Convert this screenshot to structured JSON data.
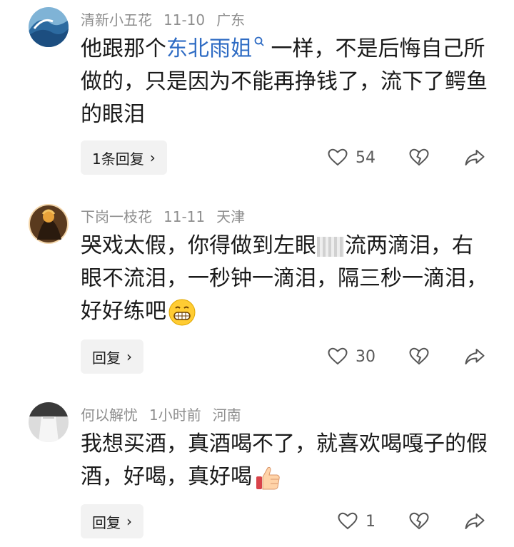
{
  "comments": [
    {
      "username": "清新小五花",
      "date": "11-10",
      "location": "广东",
      "text_before": "他跟那个",
      "link_text": "东北雨姐",
      "text_after": "一样，不是后悔自己所做的，只是因为不能再挣钱了，流下了鳄鱼的眼泪",
      "reply_label": "1条回复",
      "likes": "54"
    },
    {
      "username": "下岗一枝花",
      "date": "11-11",
      "location": "天津",
      "text_before": "哭戏太假，你得做到左眼",
      "text_middle": "流两滴泪，右眼不流泪，一秒钟一滴泪，隔三秒一滴泪，好好练吧",
      "reply_label": "回复",
      "likes": "30"
    },
    {
      "username": "何以解忧",
      "date": "1小时前",
      "location": "河南",
      "text": "我想买酒，真酒喝不了，就喜欢喝嘎子的假酒，好喝，真好喝",
      "reply_label": "回复",
      "likes": "1"
    }
  ],
  "icons": {
    "like": "heart-outline-icon",
    "dislike": "broken-heart-icon",
    "share": "share-arrow-icon",
    "emoji_grin": "grinning-face-emoji",
    "emoji_thumb": "thumbs-up-emoji"
  },
  "colors": {
    "link": "#2f6cc4",
    "meta": "#8e8e8e",
    "reply_bg": "#f2f2f2"
  }
}
